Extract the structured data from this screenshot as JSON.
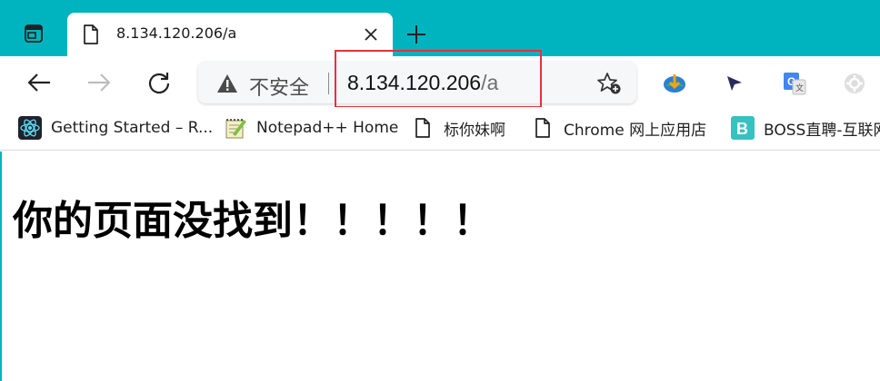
{
  "tab": {
    "title": "8.134.120.206/a"
  },
  "omnibox": {
    "security_label": "不安全",
    "url_host": "8.134.120.206",
    "url_path": "/a"
  },
  "bookmarks": [
    {
      "label": "Getting Started – R...",
      "icon": "react-icon"
    },
    {
      "label": "Notepad++ Home",
      "icon": "notepad-icon"
    },
    {
      "label": "标你妹啊",
      "icon": "page-icon"
    },
    {
      "label": "Chrome 网上应用店",
      "icon": "page-icon"
    },
    {
      "label": "BOSS直聘-互联网",
      "icon": "boss-icon"
    }
  ],
  "page": {
    "heading": "你的页面没找到！！！！！"
  },
  "colors": {
    "tabstrip": "#00b4bf",
    "highlight": "#e8303e"
  }
}
